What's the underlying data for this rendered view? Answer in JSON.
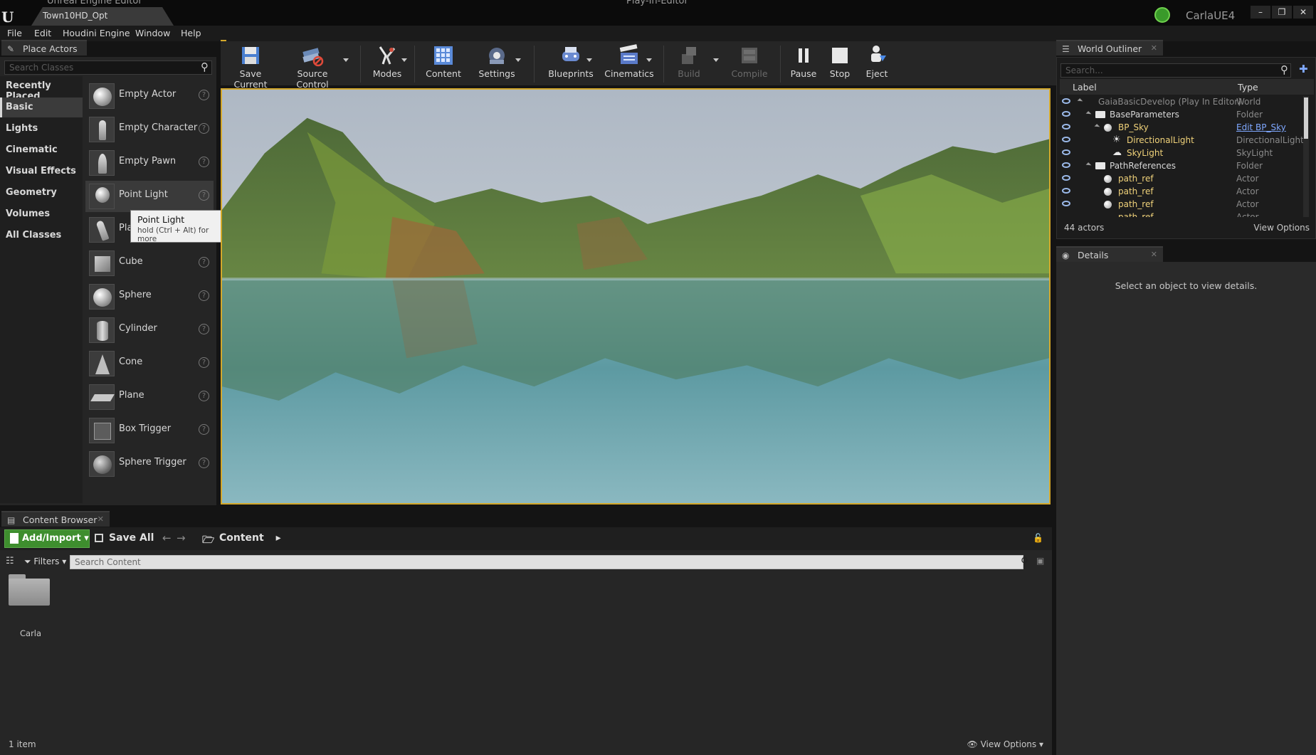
{
  "window": {
    "app_title": "Unreal Engine Editor",
    "map_tab": "Town10HD_Opt",
    "center_title": "Play-In-Editor",
    "project": "CarlaUE4",
    "controls": [
      "–",
      "❐",
      "✕"
    ]
  },
  "menu": [
    "File",
    "Edit",
    "Houdini Engine",
    "Window",
    "Help"
  ],
  "place_actors": {
    "tab_label": "Place Actors",
    "search_placeholder": "Search Classes",
    "categories": [
      {
        "label": "Recently Placed",
        "active": false
      },
      {
        "label": "Basic",
        "active": true
      },
      {
        "label": "Lights",
        "active": false
      },
      {
        "label": "Cinematic",
        "active": false
      },
      {
        "label": "Visual Effects",
        "active": false
      },
      {
        "label": "Geometry",
        "active": false
      },
      {
        "label": "Volumes",
        "active": false
      },
      {
        "label": "All Classes",
        "active": false
      }
    ],
    "actors": [
      {
        "label": "Empty Actor",
        "icon": "sphere-icon"
      },
      {
        "label": "Empty Character",
        "icon": "character-icon"
      },
      {
        "label": "Empty Pawn",
        "icon": "pawn-icon"
      },
      {
        "label": "Point Light",
        "icon": "lightbulb-icon"
      },
      {
        "label": "Pla",
        "icon": "player-start-icon"
      },
      {
        "label": "Cube",
        "icon": "cube-icon"
      },
      {
        "label": "Sphere",
        "icon": "sphere-icon"
      },
      {
        "label": "Cylinder",
        "icon": "cylinder-icon"
      },
      {
        "label": "Cone",
        "icon": "cone-icon"
      },
      {
        "label": "Plane",
        "icon": "plane-icon"
      },
      {
        "label": "Box Trigger",
        "icon": "box-trigger-icon"
      },
      {
        "label": "Sphere Trigger",
        "icon": "sphere-trigger-icon"
      }
    ],
    "help_glyph": "?",
    "tooltip": {
      "title": "Point Light",
      "hint": "hold (Ctrl + Alt) for more"
    }
  },
  "toolbar": {
    "buttons": [
      {
        "label": "Save Current",
        "icon": "save-icon",
        "enabled": true
      },
      {
        "label": "Source Control",
        "icon": "source-control-icon",
        "enabled": true
      },
      {
        "label": "Modes",
        "icon": "modes-icon",
        "enabled": true
      },
      {
        "label": "Content",
        "icon": "content-icon",
        "enabled": true
      },
      {
        "label": "Settings",
        "icon": "settings-icon",
        "enabled": true
      },
      {
        "label": "Blueprints",
        "icon": "blueprints-icon",
        "enabled": true
      },
      {
        "label": "Cinematics",
        "icon": "cinematics-icon",
        "enabled": true
      },
      {
        "label": "Build",
        "icon": "build-icon",
        "enabled": false
      },
      {
        "label": "Compile",
        "icon": "compile-icon",
        "enabled": false
      },
      {
        "label": "Pause",
        "icon": "pause-icon",
        "enabled": true
      },
      {
        "label": "Stop",
        "icon": "stop-icon",
        "enabled": true
      },
      {
        "label": "Eject",
        "icon": "eject-icon",
        "enabled": true
      }
    ]
  },
  "viewport": {
    "accent": "#d4a82a"
  },
  "outliner": {
    "tab_label": "World Outliner",
    "search_placeholder": "Search...",
    "col_label": "Label",
    "col_type": "Type",
    "rows": [
      {
        "label": "GaiaBasicDevelop (Play In Editor)",
        "type": "World",
        "style": "dim"
      },
      {
        "label": "BaseParameters",
        "type": "Folder",
        "style": "normal"
      },
      {
        "label": "BP_Sky",
        "type": "Edit BP_Sky",
        "style": "gold",
        "type_style": "link"
      },
      {
        "label": "DirectionalLight",
        "type": "DirectionalLight",
        "style": "gold"
      },
      {
        "label": "SkyLight",
        "type": "SkyLight",
        "style": "gold"
      },
      {
        "label": "PathReferences",
        "type": "Folder",
        "style": "normal"
      },
      {
        "label": "path_ref",
        "type": "Actor",
        "style": "gold"
      },
      {
        "label": "path_ref",
        "type": "Actor",
        "style": "gold"
      },
      {
        "label": "path_ref",
        "type": "Actor",
        "style": "gold"
      },
      {
        "label": "path_ref",
        "type": "Actor",
        "style": "gold"
      }
    ],
    "actor_count": "44 actors",
    "view_options": "View Options"
  },
  "details": {
    "tab_label": "Details",
    "empty_message": "Select an object to view details."
  },
  "content_browser": {
    "tab_label": "Content Browser",
    "add_import": "Add/Import",
    "save_all": "Save All",
    "path": "Content",
    "filters": "Filters",
    "search_placeholder": "Search Content",
    "folders": [
      {
        "label": "Carla"
      }
    ],
    "item_count": "1 item",
    "view_options": "View Options"
  }
}
